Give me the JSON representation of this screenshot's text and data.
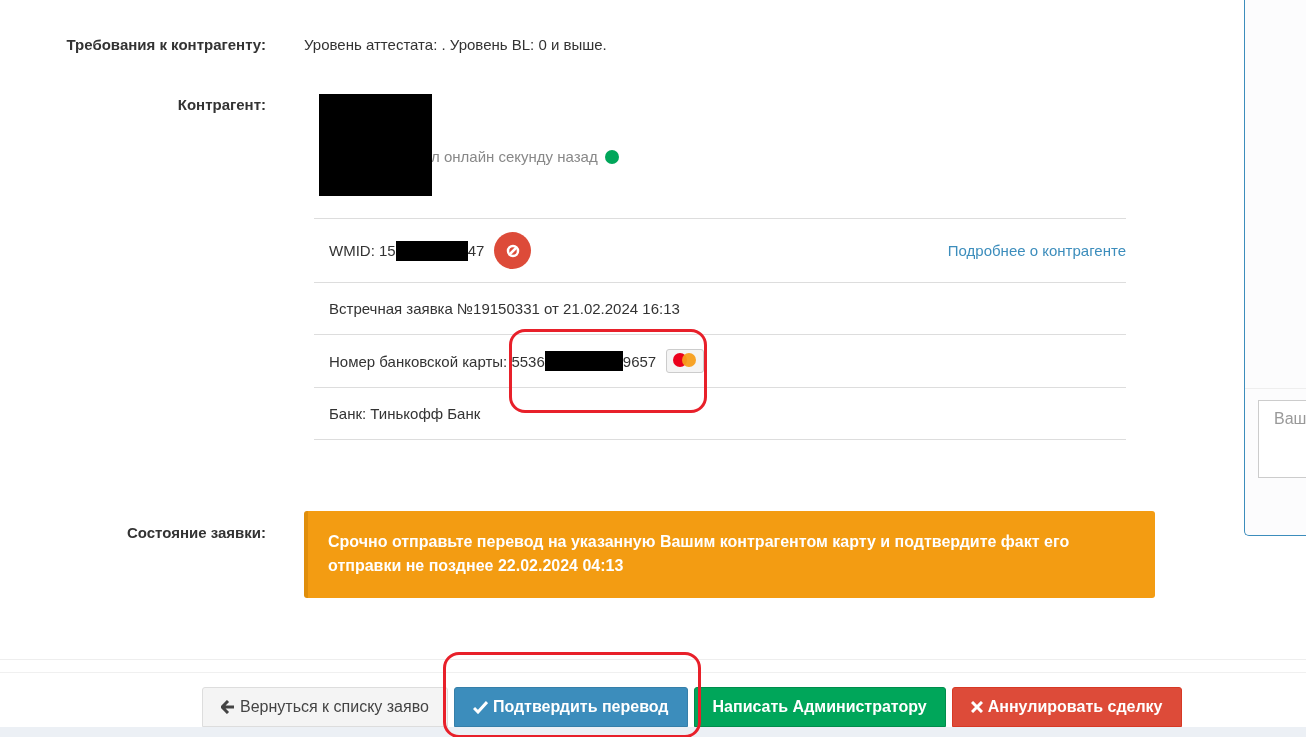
{
  "requirements": {
    "label": "Требования к контрагенту:",
    "value": "Уровень аттестата: . Уровень BL: 0 и выше."
  },
  "contractor": {
    "label": "Контрагент:",
    "online_text": "л онлайн секунду назад",
    "online": true,
    "wmid_prefix": "WMID: 15",
    "wmid_suffix": "47",
    "details_link": "Подробнее о контрагенте",
    "counter_order": "Встречная заявка №19150331 от 21.02.2024 16:13",
    "card_prefix": "Номер банковской карты: 5536",
    "card_suffix": "9657",
    "bank": "Банк: Тинькофф Банк"
  },
  "status": {
    "label": "Состояние заявки:",
    "message": "Срочно отправьте перевод на указанную Вашим контрагентом карту и подтвердите факт его отправки не позднее 22.02.2024 04:13"
  },
  "side_panel": {
    "placeholder": "Ваш"
  },
  "buttons": [
    {
      "kind": "back",
      "label": "Вернуться к списку заяво"
    },
    {
      "kind": "confirm",
      "label": "Подтвердить перевод"
    },
    {
      "kind": "admin",
      "label": "Написать Администратору"
    },
    {
      "kind": "cancel",
      "label": "Аннулировать сделку"
    }
  ]
}
